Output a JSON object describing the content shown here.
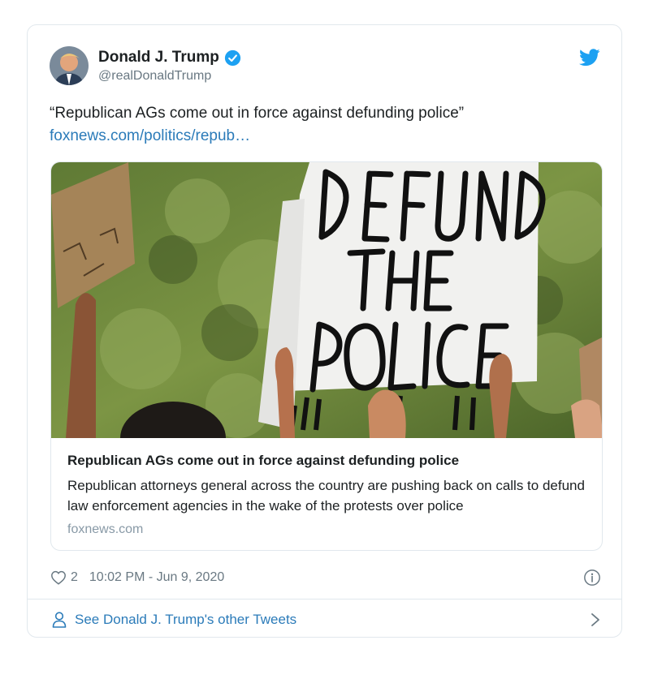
{
  "author": {
    "name": "Donald J. Trump",
    "handle": "@realDonaldTrump",
    "verified_icon": "verified-badge-icon",
    "avatar_icon": "avatar"
  },
  "tweet": {
    "text": "“Republican AGs come out in force against defunding police”",
    "link_text": "foxnews.com/politics/repub…"
  },
  "link_card": {
    "image_sign_text": [
      "DEFUND",
      "THE",
      "POLICE"
    ],
    "title": "Republican AGs come out in force against defunding police",
    "description": "Republican attorneys general across the country are pushing back on calls to defund law enforcement agencies in the wake of the protests over police",
    "domain": "foxnews.com"
  },
  "meta": {
    "like_count": "2",
    "timestamp": "10:02 PM - Jun 9, 2020"
  },
  "footer": {
    "other_tweets_label": "See Donald J. Trump's other Tweets"
  },
  "colors": {
    "twitter_blue": "#1da1f2",
    "link_blue": "#2b7bb9",
    "secondary_text": "#697882",
    "border": "#e1e8ed"
  }
}
